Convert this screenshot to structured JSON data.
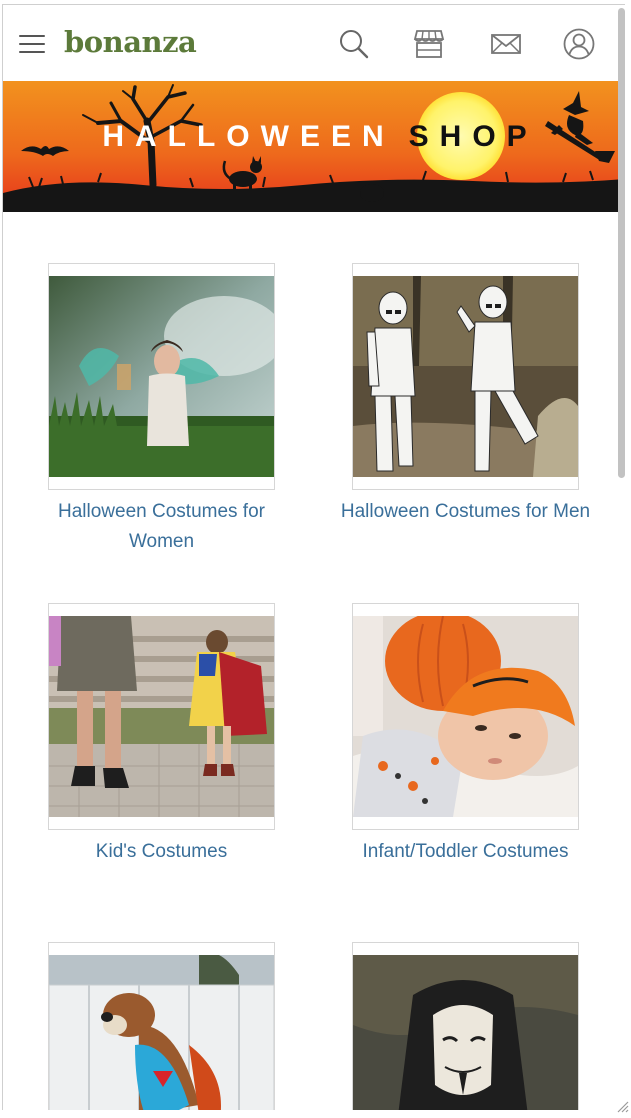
{
  "header": {
    "logo_text": "bonanza",
    "icons": [
      "menu-icon",
      "search-icon",
      "storefront-icon",
      "mail-icon",
      "account-icon"
    ]
  },
  "banner": {
    "title_word_1": "HALLOWEEN",
    "title_word_2": "SHOP"
  },
  "categories": [
    {
      "label": "Halloween Costumes for Women"
    },
    {
      "label": "Halloween Costumes for Men"
    },
    {
      "label": "Kid's Costumes"
    },
    {
      "label": "Infant/Toddler Costumes"
    },
    {
      "label": ""
    },
    {
      "label": ""
    }
  ],
  "colors": {
    "logo": "#5c7a3a",
    "link": "#3a6f9a",
    "banner_top": "#f08a1e",
    "banner_bottom": "#e83a1e"
  }
}
